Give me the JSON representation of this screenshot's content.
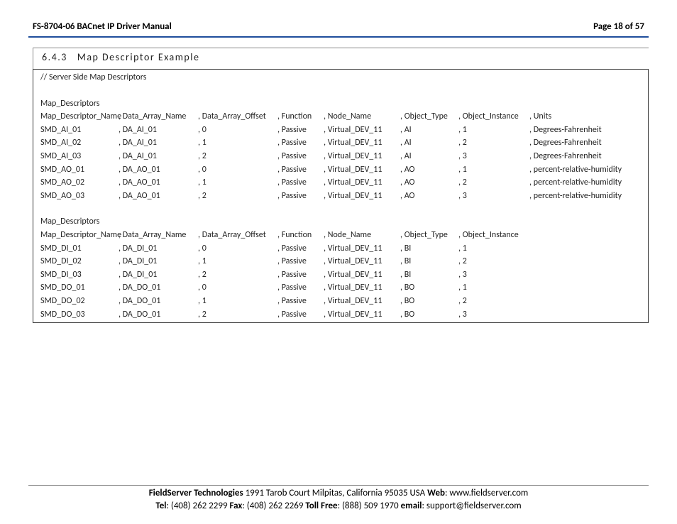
{
  "header": {
    "left": "FS-8704-06 BACnet IP Driver Manual",
    "right": "Page 18 of 57"
  },
  "section": {
    "number": "6.4.3",
    "title": "Map Descriptor Example"
  },
  "comment": "//    Server Side Map Descriptors",
  "group1": {
    "label": "Map_Descriptors",
    "headers": [
      "Map_Descriptor_Name",
      ", Data_Array_Name",
      ", Data_Array_Offset",
      ", Function",
      ", Node_Name",
      ", Object_Type",
      ", Object_Instance",
      ", Units"
    ],
    "rows": [
      [
        "SMD_AI_01",
        ", DA_AI_01",
        ", 0",
        ", Passive",
        ", Virtual_DEV_11",
        ", AI",
        ", 1",
        ", Degrees-Fahrenheit"
      ],
      [
        "SMD_AI_02",
        ", DA_AI_01",
        ", 1",
        ", Passive",
        ", Virtual_DEV_11",
        ", AI",
        ", 2",
        ", Degrees-Fahrenheit"
      ],
      [
        "SMD_AI_03",
        ", DA_AI_01",
        ", 2",
        ", Passive",
        ", Virtual_DEV_11",
        ", AI",
        ", 3",
        ", Degrees-Fahrenheit"
      ],
      [
        "SMD_AO_01",
        ", DA_AO_01",
        ", 0",
        ", Passive",
        ", Virtual_DEV_11",
        ", AO",
        ", 1",
        ", percent-relative-humidity"
      ],
      [
        "SMD_AO_02",
        ", DA_AO_01",
        ", 1",
        ", Passive",
        ", Virtual_DEV_11",
        ", AO",
        ", 2",
        ", percent-relative-humidity"
      ],
      [
        "SMD_AO_03",
        ", DA_AO_01",
        ", 2",
        ", Passive",
        ", Virtual_DEV_11",
        ", AO",
        ", 3",
        ", percent-relative-humidity"
      ]
    ]
  },
  "group2": {
    "label": "Map_Descriptors",
    "headers": [
      "Map_Descriptor_Name",
      ", Data_Array_Name",
      ", Data_Array_Offset",
      ", Function",
      ", Node_Name",
      ", Object_Type",
      ", Object_Instance"
    ],
    "rows": [
      [
        "SMD_DI_01",
        ", DA_DI_01",
        ", 0",
        ", Passive",
        ", Virtual_DEV_11",
        ", BI",
        ", 1"
      ],
      [
        "SMD_DI_02",
        ", DA_DI_01",
        ", 1",
        ", Passive",
        ", Virtual_DEV_11",
        ", BI",
        ", 2"
      ],
      [
        "SMD_DI_03",
        ", DA_DI_01",
        ", 2",
        ", Passive",
        ", Virtual_DEV_11",
        ", BI",
        ", 3"
      ],
      [
        "SMD_DO_01",
        ", DA_DO_01",
        ", 0",
        ", Passive",
        ", Virtual_DEV_11",
        ", BO",
        ", 1"
      ],
      [
        "SMD_DO_02",
        ", DA_DO_01",
        ", 1",
        ", Passive",
        ", Virtual_DEV_11",
        ", BO",
        ", 2"
      ],
      [
        "SMD_DO_03",
        ", DA_DO_01",
        ", 2",
        ", Passive",
        ", Virtual_DEV_11",
        ", BO",
        ", 3"
      ]
    ]
  },
  "footer": {
    "company_label": "FieldServer Technologies",
    "address": " 1991 Tarob Court Milpitas, California 95035 USA   ",
    "web_label": "Web",
    "web": ": www.fieldserver.com",
    "tel_label": "Tel",
    "tel": ": (408) 262 2299   ",
    "fax_label": "Fax",
    "fax": ": (408) 262 2269   ",
    "toll_label": "Toll Free",
    "toll": ": (888) 509 1970   ",
    "email_label": "email",
    "email": ": support@fieldserver.com"
  }
}
